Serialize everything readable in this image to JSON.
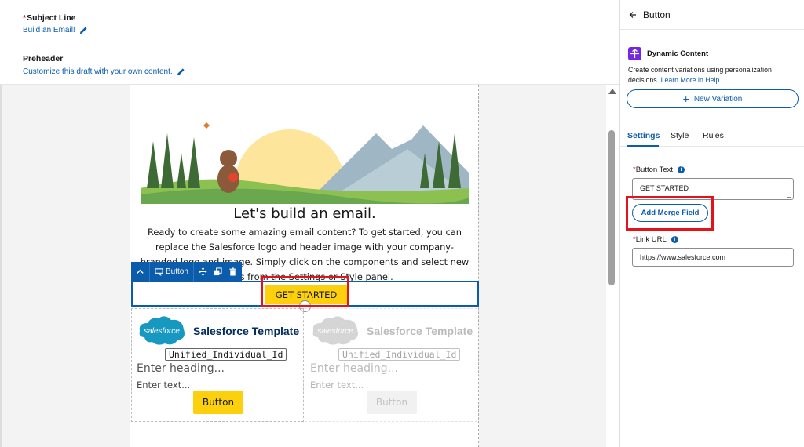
{
  "header": {
    "subject_label": "Subject Line",
    "subject_value": "Build an Email!",
    "preheader_label": "Preheader",
    "preheader_value": "Customize this draft with your own content."
  },
  "email": {
    "headline": "Let's build an email.",
    "body": "Ready to create some amazing email content? To get started, you can replace the Salesforce logo and header image with your company-branded logo and image. Simply click on the components and select new assets from the Settings or Style panel.",
    "cta_label": "GET STARTED",
    "toolbar": {
      "component_label": "Button"
    },
    "template_columns": [
      {
        "logo_text": "salesforce",
        "title": "Salesforce Template",
        "merge": "Unified_Individual_Id",
        "heading_placeholder": "Enter heading...",
        "text_placeholder": "Enter text...",
        "button_label": "Button"
      },
      {
        "logo_text": "salesforce",
        "title": "Salesforce Template",
        "merge": "Unified_Individual_Id",
        "heading_placeholder": "Enter heading...",
        "text_placeholder": "Enter text...",
        "button_label": "Button"
      }
    ]
  },
  "panel": {
    "back_label": "Button",
    "dc_title": "Dynamic Content",
    "dc_desc": "Create content variations using personalization decisions.",
    "dc_link": "Learn More in Help",
    "new_variation": "New Variation",
    "tabs": [
      "Settings",
      "Style",
      "Rules"
    ],
    "button_text_label": "Button Text",
    "button_text_value": "GET STARTED",
    "merge_field_label": "Add Merge Field",
    "link_url_label": "Link URL",
    "link_url_value": "https://www.salesforce.com"
  },
  "colors": {
    "brand": "#0b5cab",
    "cta": "#fcd00d",
    "highlight": "#e3131b",
    "dynamic_content": "#7526e3"
  }
}
